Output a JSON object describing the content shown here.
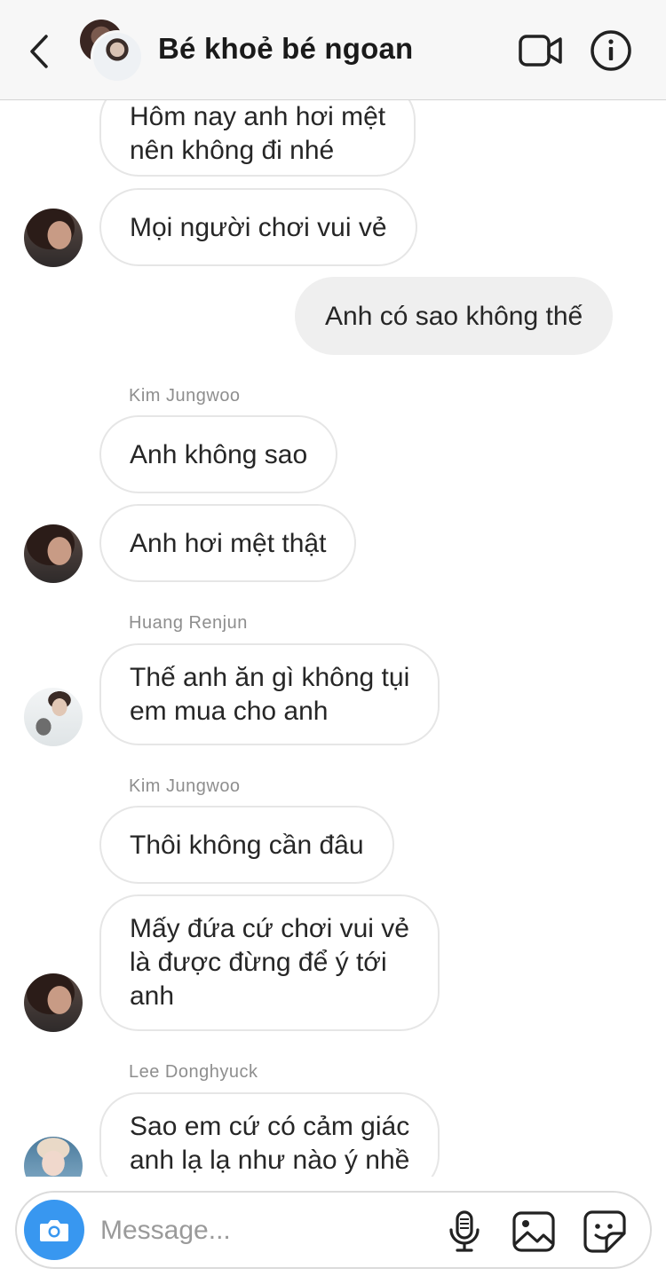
{
  "header": {
    "title": "Bé khoẻ bé ngoan",
    "back_icon": "chevron-left-icon",
    "video_icon": "video-camera-icon",
    "info_icon": "info-icon"
  },
  "messages": [
    {
      "text": "Hôm nay anh hơi mệt\nnên không đi nhé",
      "dir": "in"
    },
    {
      "text": "Mọi người chơi vui vẻ",
      "dir": "in"
    },
    {
      "text": "Anh có sao không thế",
      "dir": "out"
    },
    {
      "sender": "Kim Jungwoo"
    },
    {
      "text": "Anh không sao",
      "dir": "in"
    },
    {
      "text": "Anh hơi mệt thật",
      "dir": "in"
    },
    {
      "sender": "Huang Renjun"
    },
    {
      "text": "Thế anh ăn gì không tụi\nem mua cho anh",
      "dir": "in"
    },
    {
      "sender": "Kim Jungwoo"
    },
    {
      "text": "Thôi không cần đâu",
      "dir": "in"
    },
    {
      "text": "Mấy đứa cứ chơi vui vẻ\nlà được đừng để ý tới\nanh",
      "dir": "in"
    },
    {
      "sender": "Lee Donghyuck"
    },
    {
      "text": "Sao em cứ có cảm giác\nanh lạ lạ như nào ý nhề",
      "dir": "in"
    }
  ],
  "composer": {
    "placeholder": "Message...",
    "value": "",
    "camera_icon": "camera-icon",
    "mic_icon": "microphone-icon",
    "gallery_icon": "image-icon",
    "sticker_icon": "sticker-icon"
  },
  "colors": {
    "accent": "#3897f0",
    "bubble_border": "#e6e6e6",
    "outgoing_bubble": "#efefef",
    "header_bg": "#f7f7f7"
  }
}
